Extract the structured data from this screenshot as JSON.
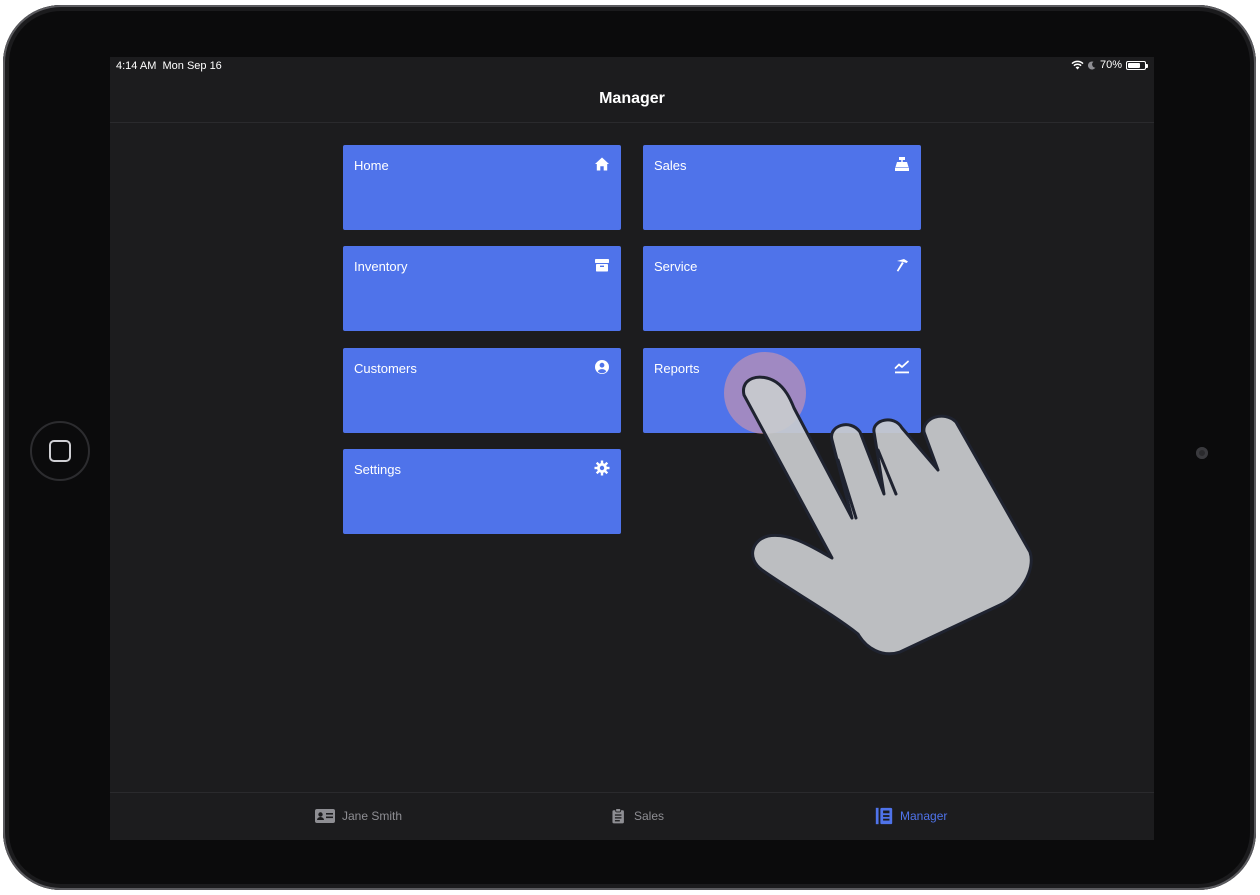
{
  "status_bar": {
    "time": "4:14 AM",
    "date": "Mon Sep 16",
    "battery": "70%"
  },
  "nav": {
    "title": "Manager"
  },
  "tiles": [
    {
      "label": "Home",
      "icon": "home-icon"
    },
    {
      "label": "Sales",
      "icon": "cash-register-icon"
    },
    {
      "label": "Inventory",
      "icon": "archive-box-icon"
    },
    {
      "label": "Service",
      "icon": "hammer-icon"
    },
    {
      "label": "Customers",
      "icon": "user-circle-icon"
    },
    {
      "label": "Reports",
      "icon": "chart-line-icon"
    },
    {
      "label": "Settings",
      "icon": "gear-icon"
    }
  ],
  "tab_bar": {
    "items": [
      {
        "label": "Jane Smith",
        "icon": "id-card-icon",
        "active": false
      },
      {
        "label": "Sales",
        "icon": "clipboard-icon",
        "active": false
      },
      {
        "label": "Manager",
        "icon": "manager-book-icon",
        "active": true
      }
    ]
  },
  "colors": {
    "tile": "#4f73ea",
    "background": "#1c1c1e",
    "tab_active": "#4f73ea",
    "tab_inactive": "#8e8e93"
  }
}
